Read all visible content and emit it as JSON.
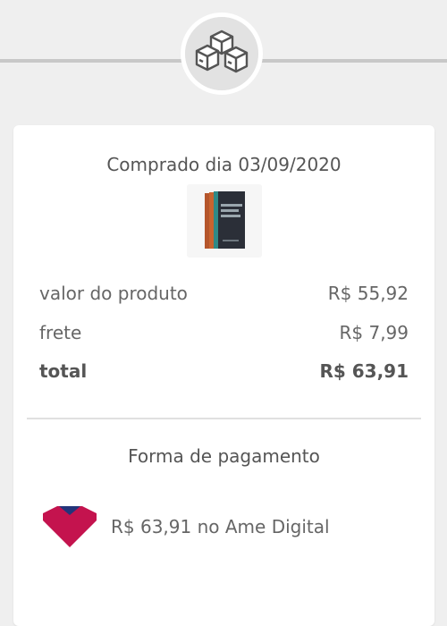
{
  "header": {
    "icon": "boxes-icon"
  },
  "order": {
    "purchase_date": "Comprado dia 03/09/2020",
    "product_image": "book-box-set-image",
    "rows": [
      {
        "label": "valor do produto",
        "value": "R$ 55,92"
      },
      {
        "label": "frete",
        "value": "R$ 7,99"
      },
      {
        "label": "total",
        "value": "R$ 63,91"
      }
    ]
  },
  "payment": {
    "title": "Forma de pagamento",
    "method_text": "R$ 63,91 no Ame Digital",
    "logo": "ame-digital-logo",
    "logo_colors": {
      "primary": "#c4134e",
      "secondary": "#23347a"
    }
  },
  "colors": {
    "background": "#efefef",
    "card": "#ffffff",
    "text": "#555555"
  }
}
